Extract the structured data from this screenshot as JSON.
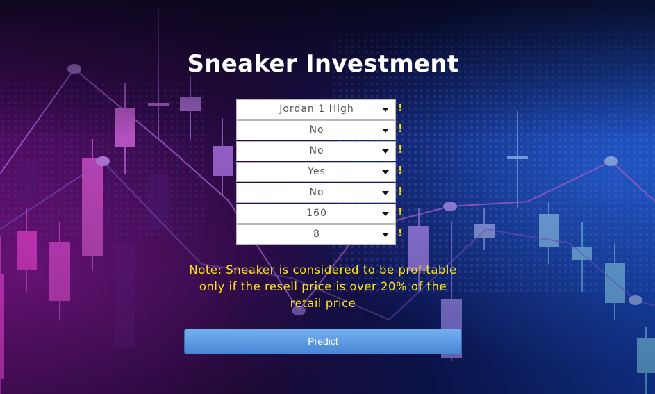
{
  "page": {
    "title": "Sneaker Investment"
  },
  "form": {
    "fields": [
      {
        "value": "Jordan 1 High",
        "marker": "!"
      },
      {
        "value": "No",
        "marker": "!"
      },
      {
        "value": "No",
        "marker": "!"
      },
      {
        "value": "Yes",
        "marker": "!"
      },
      {
        "value": "No",
        "marker": "!"
      },
      {
        "value": "160",
        "marker": "!"
      },
      {
        "value": "8",
        "marker": "!"
      }
    ]
  },
  "note": "Note: Sneaker is considered to be profitable only if the resell price is over 20% of the retail price",
  "predict_label": "Predict",
  "colors": {
    "marker": "#ffe000",
    "note": "#ffe31a",
    "button": "#5a98e0"
  },
  "icons": {
    "dropdown": "caret-down-icon",
    "background": "candlestick-chart-background"
  }
}
